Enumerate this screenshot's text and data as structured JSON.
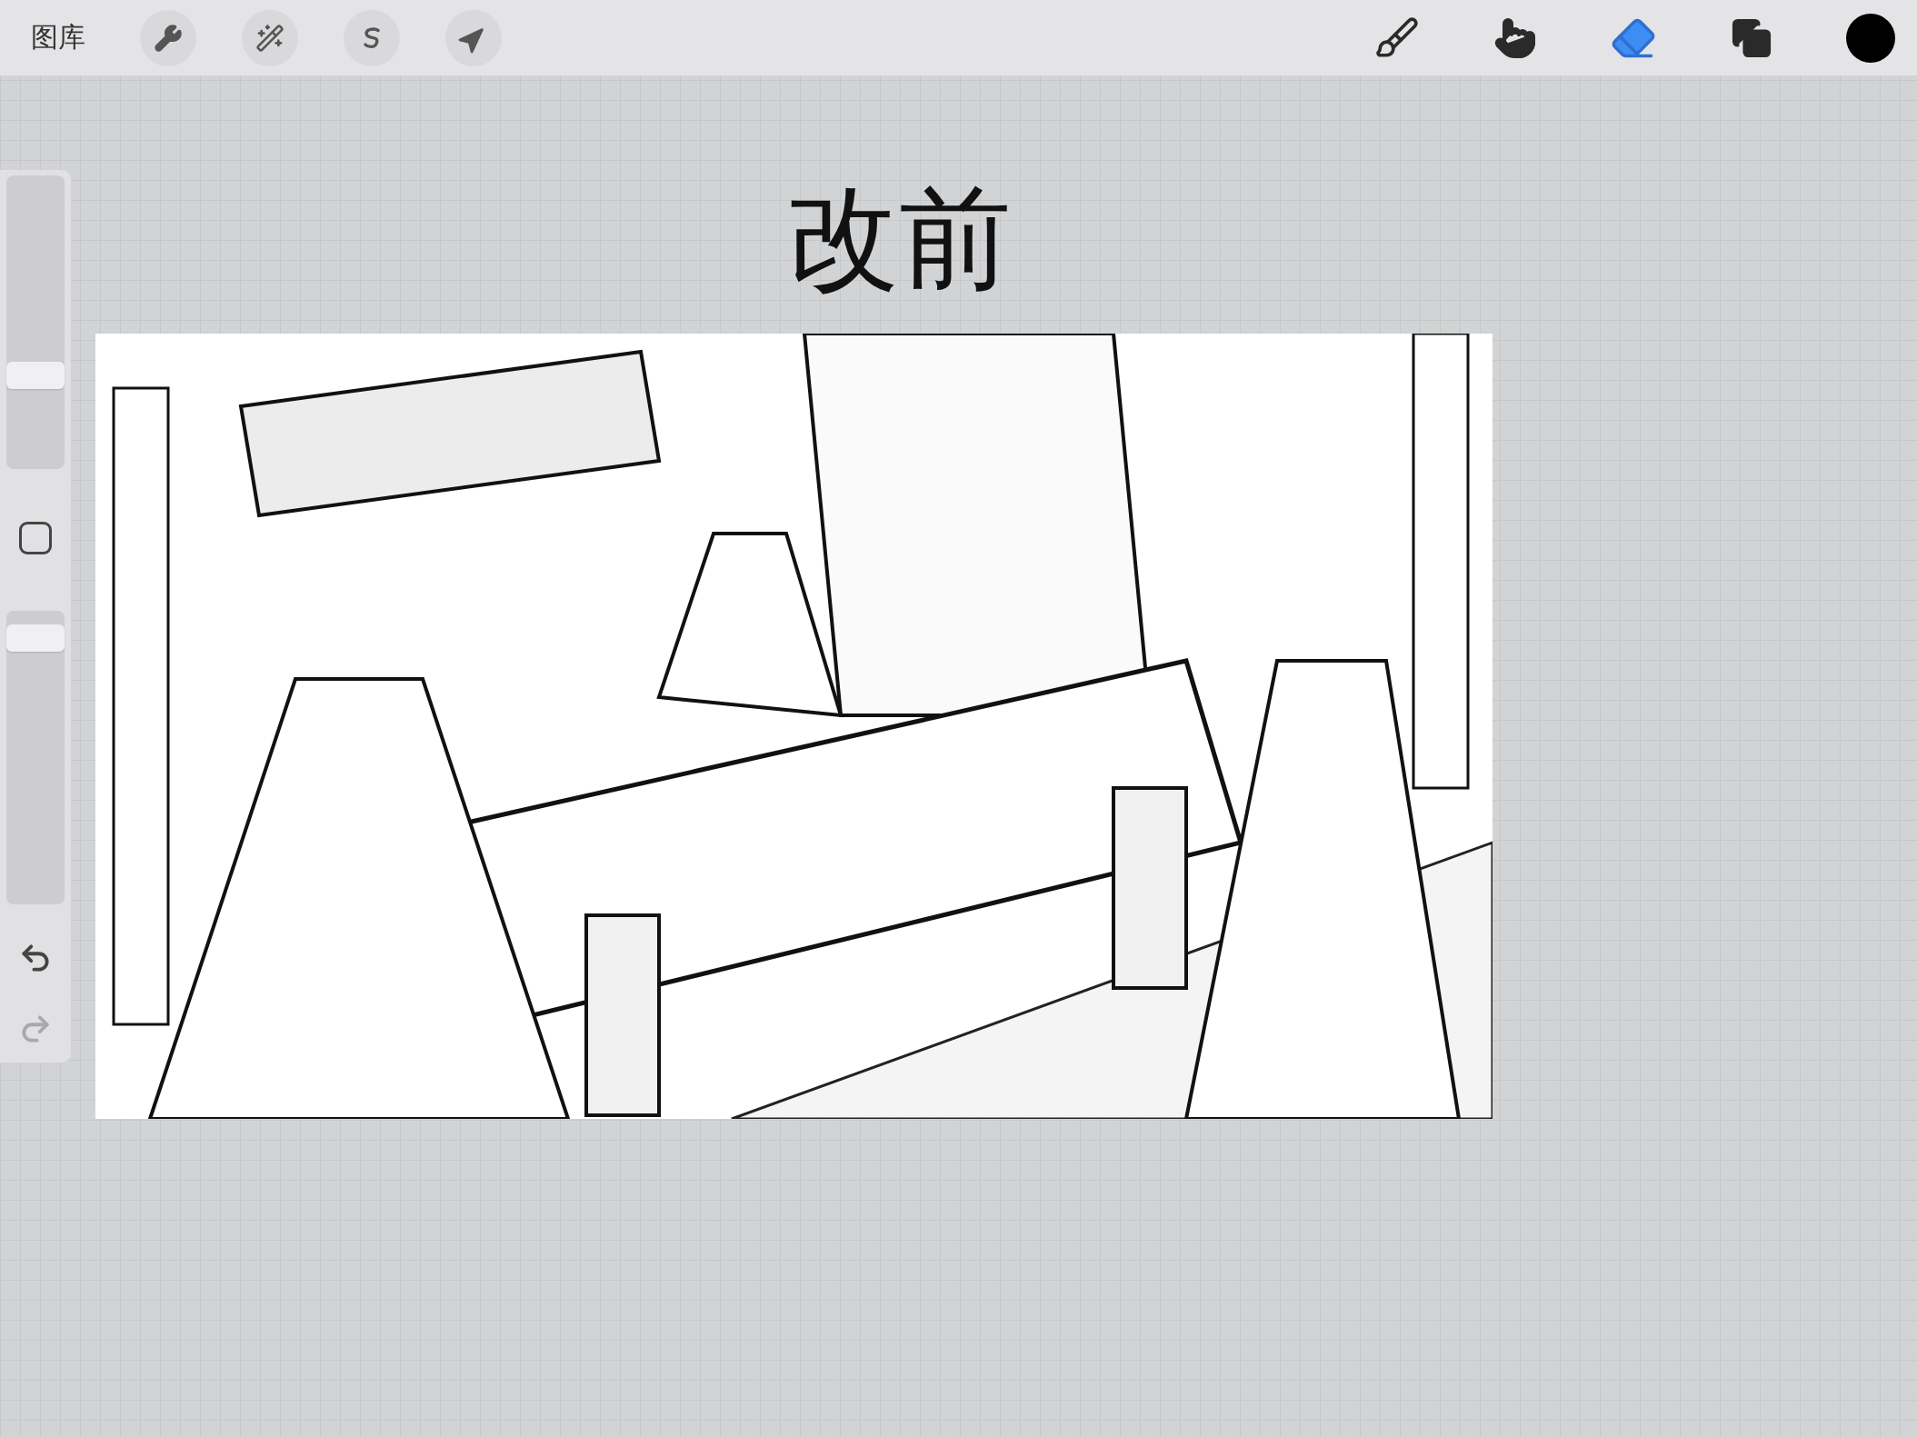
{
  "toolbar": {
    "gallery_label": "图库",
    "tools": [
      {
        "kind": "brush",
        "selected": false
      },
      {
        "kind": "smudge",
        "selected": false
      },
      {
        "kind": "eraser",
        "selected": true
      },
      {
        "kind": "layers",
        "selected": false
      }
    ],
    "color": "#000000"
  },
  "sidebar": {
    "brush_size": {
      "level": 0.3
    },
    "opacity": {
      "level": 0.95
    },
    "undo": {
      "disabled": false
    },
    "redo": {
      "disabled": true
    }
  },
  "canvas": {
    "title": "改前"
  }
}
